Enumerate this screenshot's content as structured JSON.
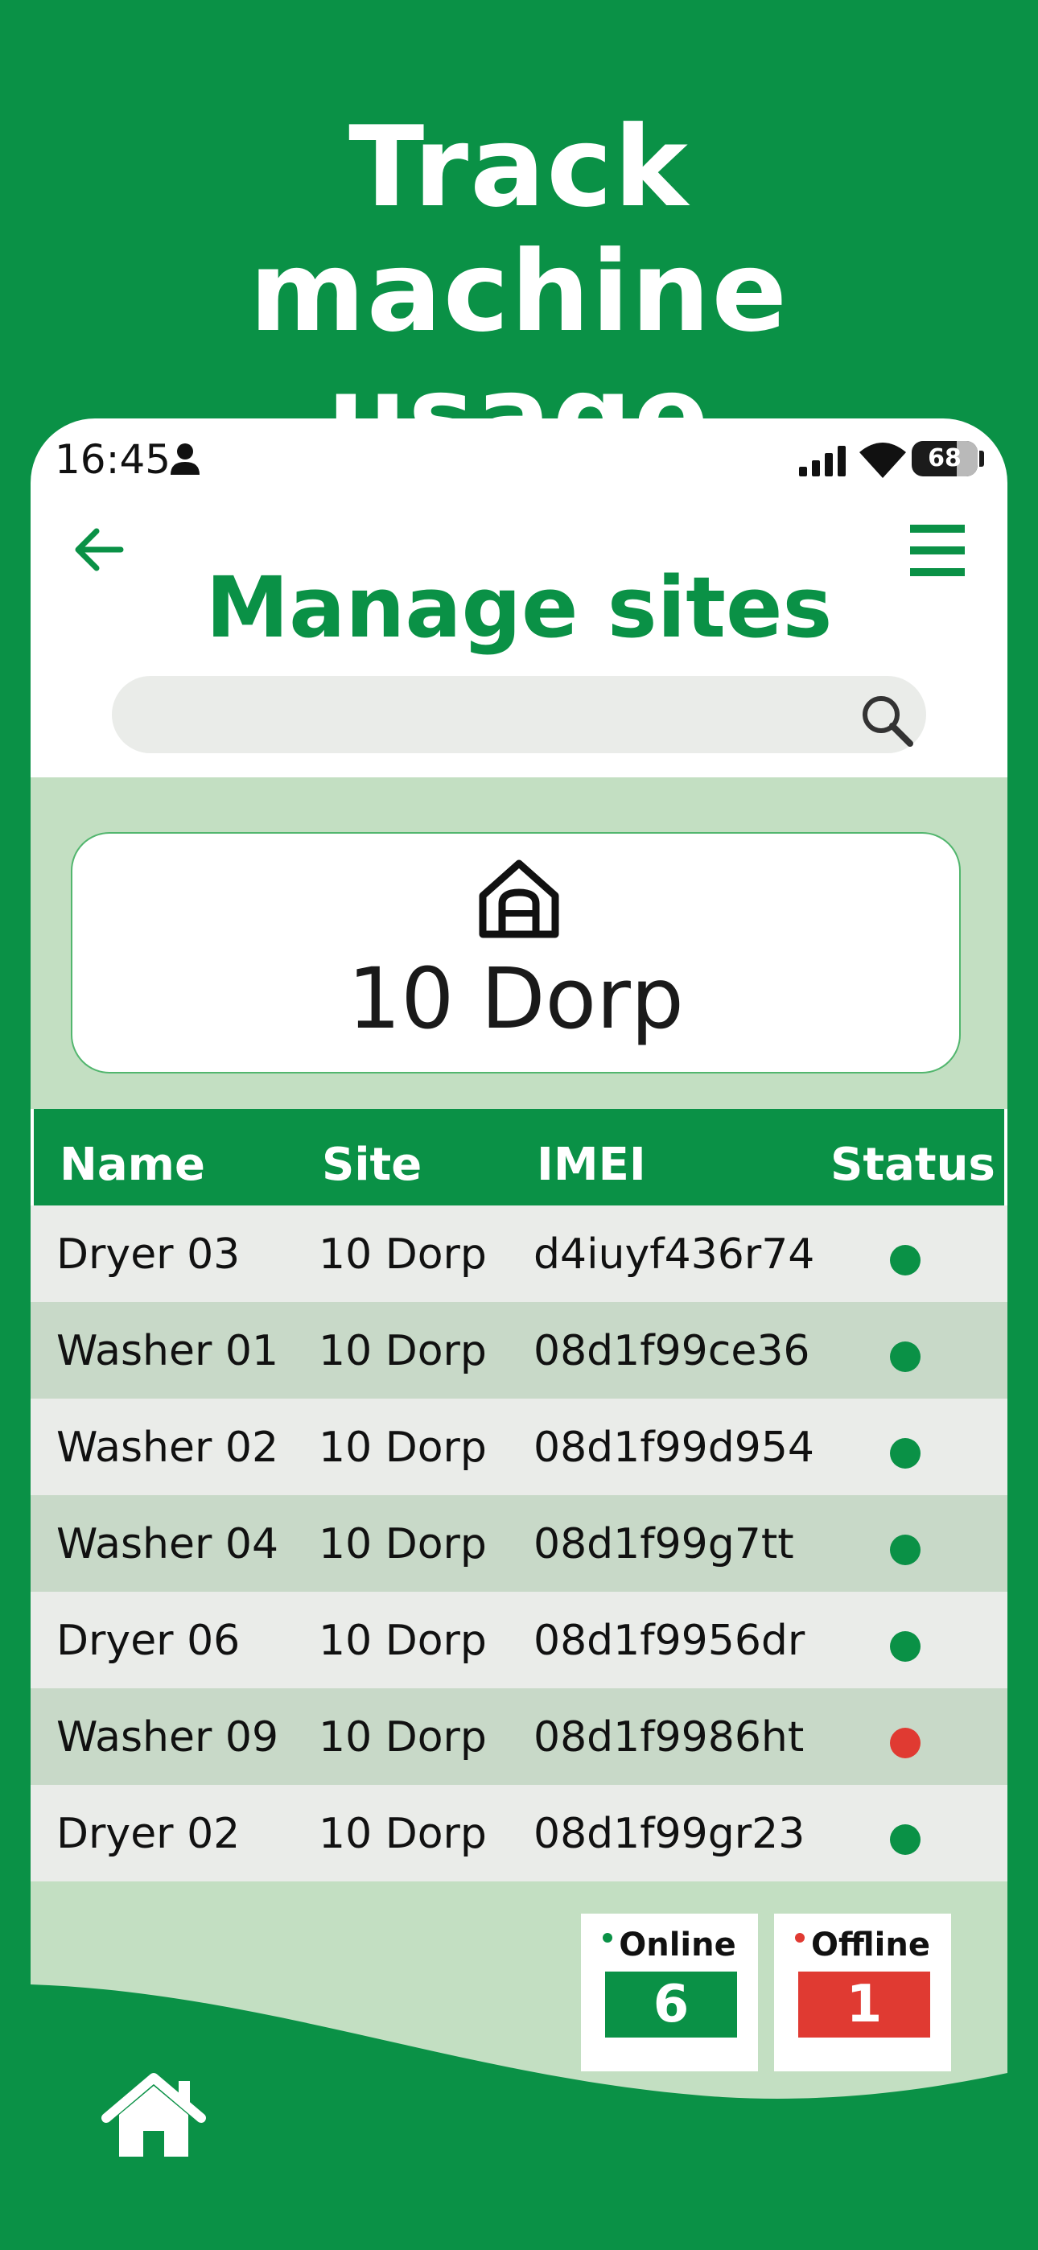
{
  "headline": "Track machine usage",
  "status_bar": {
    "time": "16:45",
    "battery": "68",
    "battery_level": 0.68
  },
  "page": {
    "title": "Manage sites"
  },
  "search": {
    "value": "",
    "placeholder": ""
  },
  "site_card": {
    "name": "10 Dorp",
    "icon": "house-icon"
  },
  "table": {
    "columns": [
      "Name",
      "Site",
      "IMEI",
      "Status"
    ],
    "rows": [
      {
        "name": "Dryer 03",
        "site": "10 Dorp",
        "imei": "d4iuyf436r74",
        "status": "online"
      },
      {
        "name": "Washer 01",
        "site": "10 Dorp",
        "imei": "08d1f99ce36",
        "status": "online"
      },
      {
        "name": "Washer 02",
        "site": "10 Dorp",
        "imei": "08d1f99d954",
        "status": "online"
      },
      {
        "name": "Washer 04",
        "site": "10 Dorp",
        "imei": "08d1f99g7tt",
        "status": "online"
      },
      {
        "name": "Dryer 06",
        "site": "10 Dorp",
        "imei": "08d1f9956dr",
        "status": "online"
      },
      {
        "name": "Washer 09",
        "site": "10 Dorp",
        "imei": "08d1f9986ht",
        "status": "offline"
      },
      {
        "name": "Dryer 02",
        "site": "10 Dorp",
        "imei": "08d1f99gr23",
        "status": "online"
      }
    ]
  },
  "summary": {
    "online_label": "Online",
    "online_count": "6",
    "offline_label": "Offline",
    "offline_count": "1"
  },
  "colors": {
    "brand_green": "#0a9146",
    "online": "#0a9146",
    "offline": "#e03a32",
    "panel_bg": "#c3dfc2"
  },
  "icons": {
    "back": "arrow-left-icon",
    "menu": "hamburger-menu-icon",
    "search": "magnifier-icon",
    "nav_home": "home-icon"
  }
}
